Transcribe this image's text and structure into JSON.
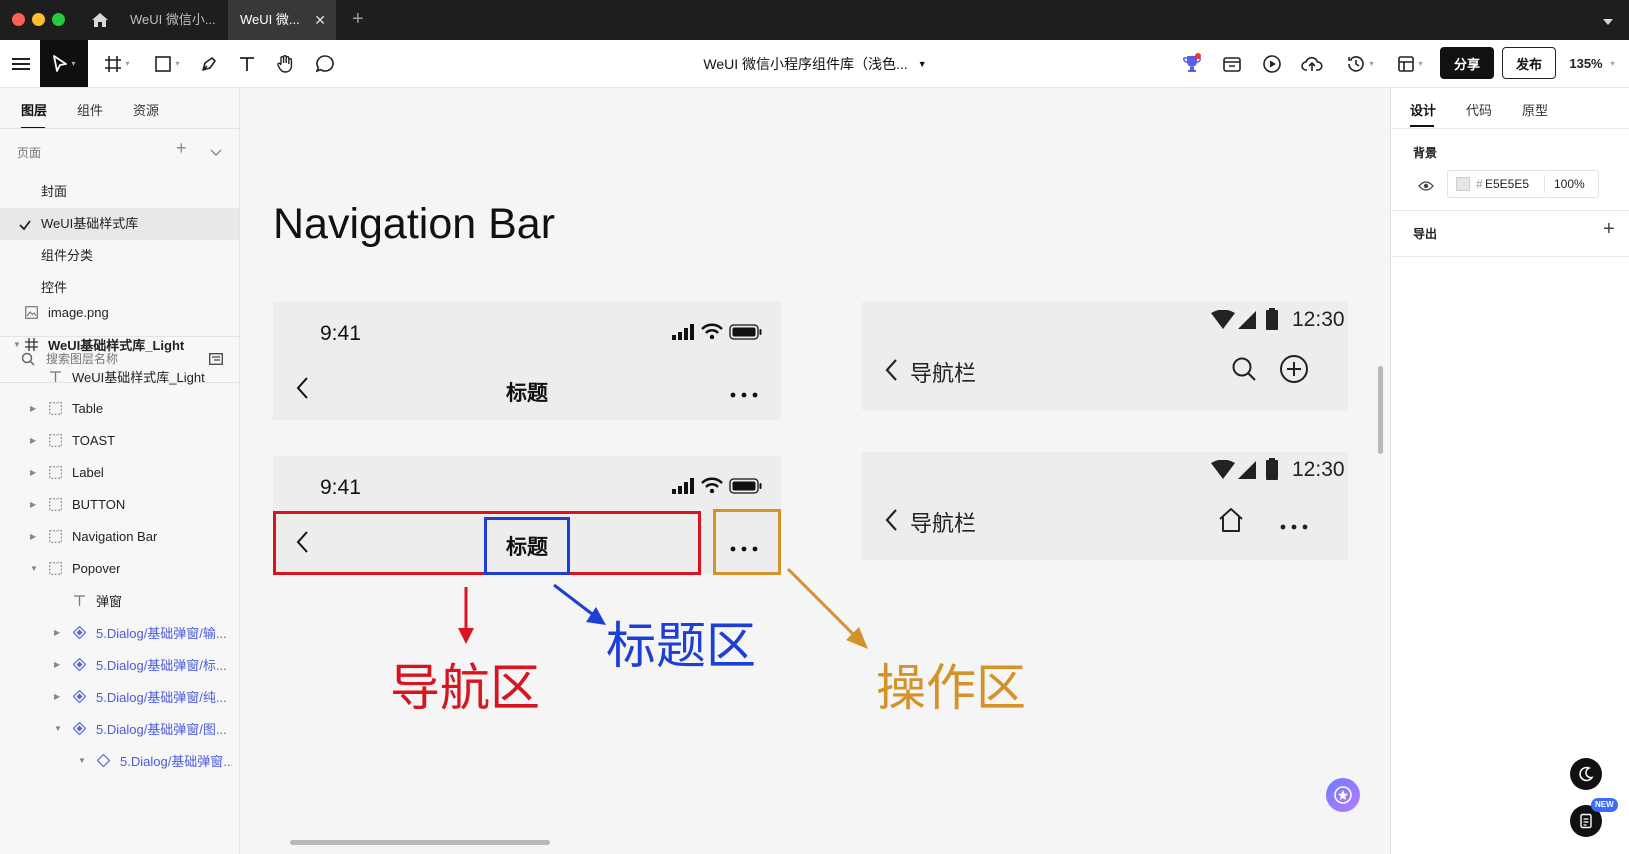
{
  "window": {
    "tabs": [
      {
        "label": "WeUI 微信小..."
      },
      {
        "label": "WeUI 微..."
      }
    ]
  },
  "toolbar": {
    "file_title": "WeUI 微信小程序组件库（浅色...",
    "share_label": "分享",
    "publish_label": "发布",
    "zoom": "135%"
  },
  "left_panel": {
    "tabs": [
      "图层",
      "组件",
      "资源"
    ],
    "pages_header": "页面",
    "pages": [
      "封面",
      "WeUI基础样式库",
      "组件分类",
      "控件"
    ],
    "search_placeholder": "搜索图层名称",
    "layers": [
      {
        "label": "image.png",
        "icon": "image-icon"
      },
      {
        "label": "WeUI基础样式库_Light",
        "icon": "frame-icon",
        "bold": true
      },
      {
        "label": "WeUI基础样式库_Light",
        "icon": "text-icon"
      },
      {
        "label": "Table",
        "icon": "group-icon"
      },
      {
        "label": "TOAST",
        "icon": "group-icon"
      },
      {
        "label": "Label",
        "icon": "group-icon"
      },
      {
        "label": "BUTTON",
        "icon": "group-icon"
      },
      {
        "label": "Navigation Bar",
        "icon": "group-icon"
      },
      {
        "label": "Popover",
        "icon": "group-icon"
      },
      {
        "label": "弹窗",
        "icon": "text-icon"
      },
      {
        "label": "5.Dialog/基础弹窗/输...",
        "icon": "component-icon"
      },
      {
        "label": "5.Dialog/基础弹窗/标...",
        "icon": "component-icon"
      },
      {
        "label": "5.Dialog/基础弹窗/纯...",
        "icon": "component-icon"
      },
      {
        "label": "5.Dialog/基础弹窗/图...",
        "icon": "component-icon"
      },
      {
        "label": "5.Dialog/基础弹窗...",
        "icon": "instance-icon"
      }
    ]
  },
  "canvas": {
    "heading": "Navigation Bar",
    "ios_time": "9:41",
    "android_time": "12:30",
    "nav_title": "标题",
    "android_title": "导航栏",
    "label_nav_area": "导航区",
    "label_title_area": "标题区",
    "label_action_area": "操作区",
    "colors": {
      "nav_area": "#d7141f",
      "title_area": "#1e3fd6",
      "action_area": "#d4932a"
    }
  },
  "right_panel": {
    "tabs": [
      "设计",
      "代码",
      "原型"
    ],
    "background_label": "背景",
    "bg_hex": "E5E5E5",
    "bg_opacity": "100%",
    "export_label": "导出"
  },
  "floating": {
    "new_badge": "NEW"
  }
}
